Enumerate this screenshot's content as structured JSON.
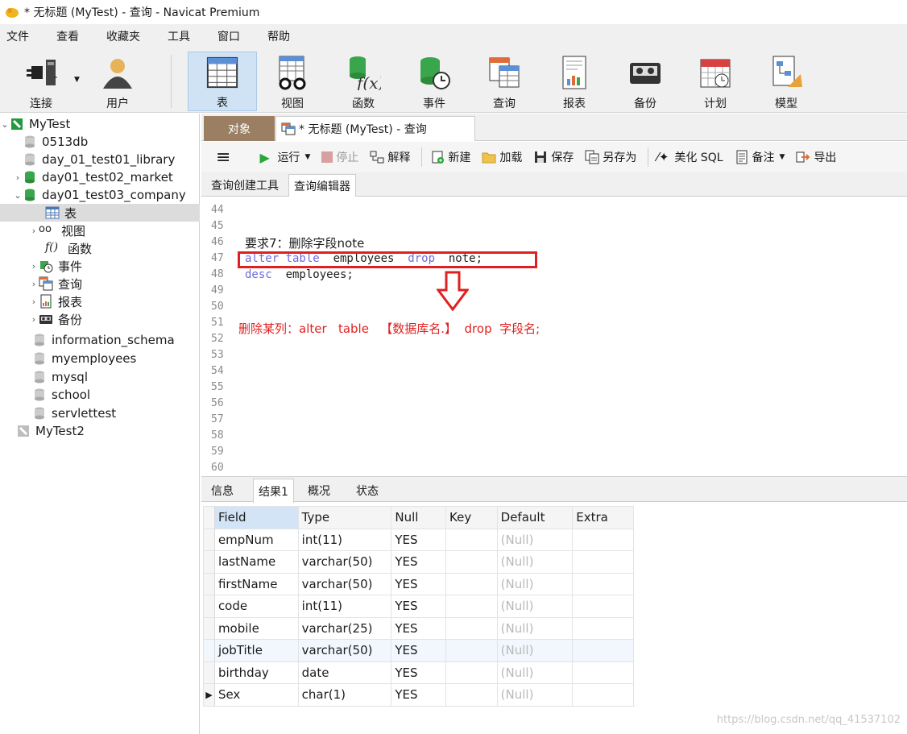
{
  "window": {
    "title": "* 无标题 (MyTest) - 查询 - Navicat Premium"
  },
  "menu": [
    "文件",
    "查看",
    "收藏夹",
    "工具",
    "窗口",
    "帮助"
  ],
  "toolbar": [
    {
      "label": "连接",
      "icon": "plug-icon"
    },
    {
      "label": "用户",
      "icon": "user-icon"
    },
    {
      "label": "表",
      "icon": "table-icon"
    },
    {
      "label": "视图",
      "icon": "view-glasses-icon"
    },
    {
      "label": "函数",
      "icon": "function-icon"
    },
    {
      "label": "事件",
      "icon": "event-clock-icon"
    },
    {
      "label": "查询",
      "icon": "query-icon"
    },
    {
      "label": "报表",
      "icon": "report-icon"
    },
    {
      "label": "备份",
      "icon": "backup-icon"
    },
    {
      "label": "计划",
      "icon": "calendar-icon"
    },
    {
      "label": "模型",
      "icon": "model-icon"
    }
  ],
  "tree": {
    "conn1": "MyTest",
    "dbs": [
      "0513db",
      "day_01_test01_library",
      "day01_test02_market",
      "day01_test03_company"
    ],
    "children": [
      "表",
      "视图",
      "函数",
      "事件",
      "查询",
      "报表",
      "备份"
    ],
    "other_dbs": [
      "information_schema",
      "myemployees",
      "mysql",
      "school",
      "servlettest"
    ],
    "conn2": "MyTest2"
  },
  "tabs": {
    "object": "对象",
    "query": "* 无标题 (MyTest) - 查询"
  },
  "query_toolbar": {
    "run": "运行",
    "stop": "停止",
    "explain": "解释",
    "new": "新建",
    "load": "加载",
    "save": "保存",
    "save_as": "另存为",
    "beautify": "美化 SQL",
    "note": "备注",
    "export": "导出"
  },
  "editor_tabs": [
    "查询创建工具",
    "查询编辑器"
  ],
  "editor": {
    "lines": [
      "44",
      "45",
      "46",
      "47",
      "48",
      "49",
      "50",
      "51",
      "52",
      "53",
      "54",
      "55",
      "56",
      "57",
      "58",
      "59",
      "60"
    ],
    "line46": "要求7：删除字段note",
    "line47_kw1": "alter table",
    "line47_mid": "  employees  ",
    "line47_kw2": "drop",
    "line47_end": "  note;",
    "line48_kw": "desc",
    "line48_end": "  employees;",
    "note": "删除某列：alter   table   【数据库名.】  drop  字段名;"
  },
  "result_tabs": [
    "信息",
    "结果1",
    "概况",
    "状态"
  ],
  "grid": {
    "headers": [
      "Field",
      "Type",
      "Null",
      "Key",
      "Default",
      "Extra"
    ],
    "rows": [
      [
        "empNum",
        "int(11)",
        "YES",
        "",
        "(Null)",
        ""
      ],
      [
        "lastName",
        "varchar(50)",
        "YES",
        "",
        "(Null)",
        ""
      ],
      [
        "firstName",
        "varchar(50)",
        "YES",
        "",
        "(Null)",
        ""
      ],
      [
        "code",
        "int(11)",
        "YES",
        "",
        "(Null)",
        ""
      ],
      [
        "mobile",
        "varchar(25)",
        "YES",
        "",
        "(Null)",
        ""
      ],
      [
        "jobTitle",
        "varchar(50)",
        "YES",
        "",
        "(Null)",
        ""
      ],
      [
        "birthday",
        "date",
        "YES",
        "",
        "(Null)",
        ""
      ],
      [
        "Sex",
        "char(1)",
        "YES",
        "",
        "(Null)",
        ""
      ]
    ]
  },
  "watermark": "https://blog.csdn.net/qq_41537102"
}
